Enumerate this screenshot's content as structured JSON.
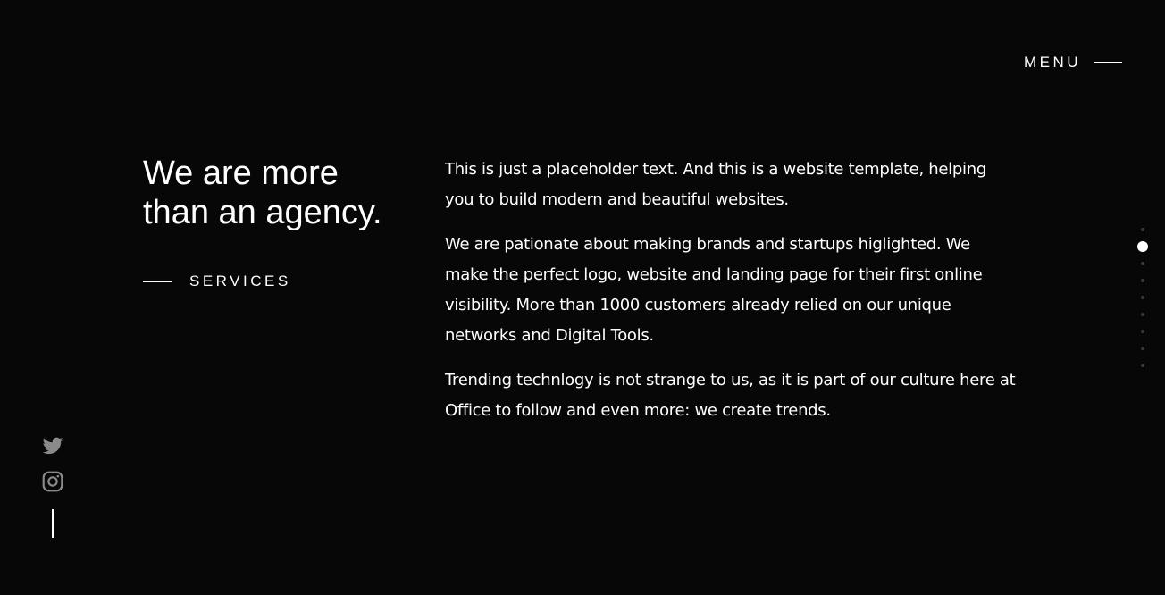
{
  "menu": {
    "label": "MENU"
  },
  "hero": {
    "headline_line1": "We are more",
    "headline_line2": "than an agency.",
    "services_label": "SERVICES"
  },
  "content": {
    "paragraphs": [
      "This is just a placeholder text. And this is a website template, helping you to build modern and beautiful websites.",
      "We are pationate about making brands and startups higlighted. We make the perfect logo, website and landing page for their first online visibility. More than 1000 customers already relied on our unique networks and Digital Tools.",
      "Trending technlogy is not strange to us, as it is part of our culture here at Office to follow and even more: we create trends."
    ]
  },
  "social": {
    "icons": [
      "twitter-icon",
      "instagram-icon"
    ]
  },
  "pagination": {
    "total": 9,
    "active_index": 1
  },
  "colors": {
    "background": "#070707",
    "text": "#ffffff",
    "icon_muted": "#8a8a8a",
    "dot_inactive": "#3a3a3a"
  }
}
